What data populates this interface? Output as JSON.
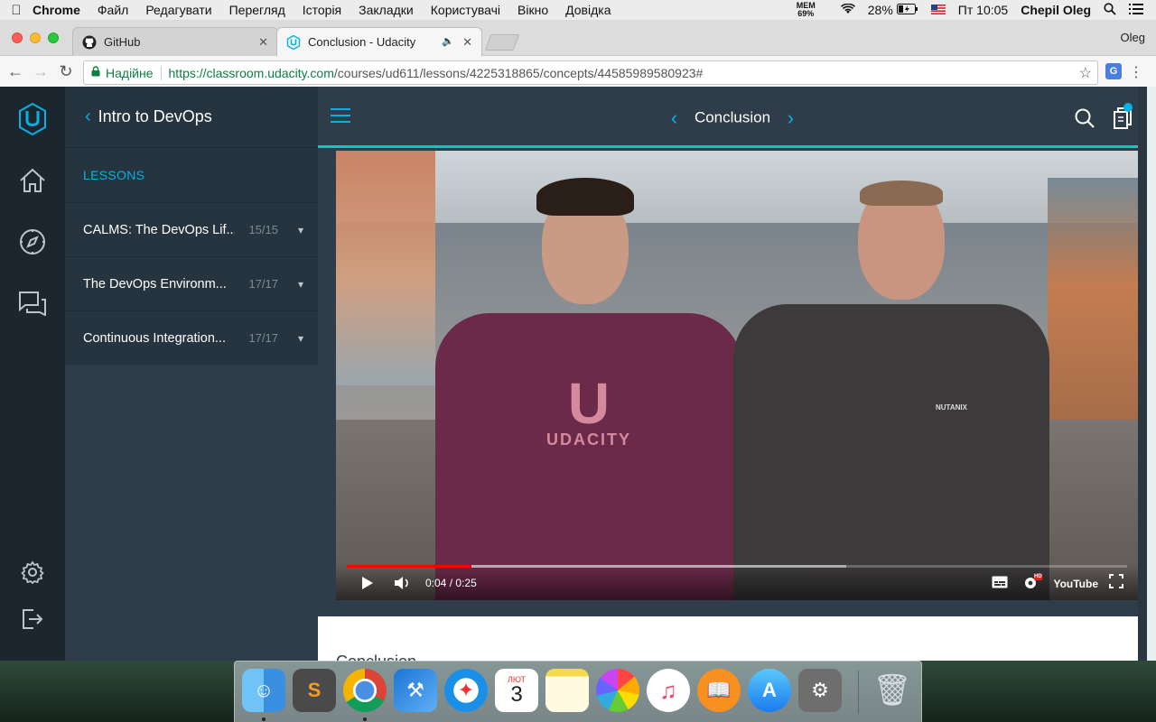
{
  "menubar": {
    "app": "Chrome",
    "items": [
      "Файл",
      "Редагувати",
      "Перегляд",
      "Історія",
      "Закладки",
      "Користувачі",
      "Вікно",
      "Довідка"
    ],
    "mem_label": "MEM",
    "mem_value": "69%",
    "battery": "28%",
    "clock": "Пт 10:05",
    "user": "Chepil Oleg"
  },
  "browser": {
    "tabs": [
      {
        "title": "GitHub"
      },
      {
        "title": "Conclusion - Udacity"
      }
    ],
    "profile": "Oleg",
    "security_label": "Надійне",
    "url_host": "https://classroom.udacity.com",
    "url_path": "/courses/ud611/lessons/4225318865/concepts/44585989580923#"
  },
  "sidebar": {
    "back_label": "Intro to DevOps",
    "section_title": "LESSONS",
    "lessons": [
      {
        "name": "CALMS: The DevOps Lif...",
        "count": "15/15"
      },
      {
        "name": "The DevOps Environm...",
        "count": "17/17"
      },
      {
        "name": "Continuous Integration...",
        "count": "17/17"
      }
    ]
  },
  "topbar": {
    "concept_title": "Conclusion"
  },
  "video": {
    "time_current": "0:04",
    "time_separator": "/",
    "time_total": "0:25",
    "progress_fraction": 0.16,
    "buffered_fraction": 0.64,
    "shirt_text": "UDACITY",
    "shirt_brand": "NUTANIX",
    "youtube_label": "YouTube",
    "hd_badge": "HD"
  },
  "content": {
    "heading": "Conclusion"
  },
  "dock": {
    "calendar_month": "ЛЮТ",
    "calendar_day": "3"
  },
  "colors": {
    "accent": "#02b3e4",
    "accent_border": "#02ccba",
    "sidebar_bg": "#2e3d49",
    "rail_bg": "#1c262f",
    "progress_red": "#ff0000"
  }
}
